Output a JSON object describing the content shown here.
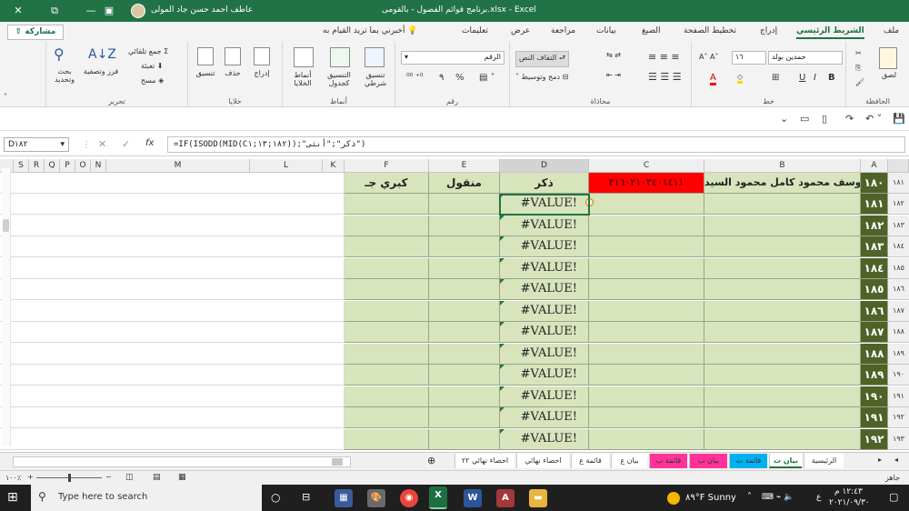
{
  "title_bar": {
    "title": "برنامج قوائم الفصول - بالقومى.xlsx - Excel",
    "user": "عاطف احمد حسن جاد المولى",
    "restore_symbol": "⧉",
    "min_symbol": "—",
    "max_symbol": "▢",
    "close_symbol": "✕"
  },
  "ribbon_tabs": [
    "ملف",
    "الشريط الرئيسي",
    "إدراج",
    "تخطيط الصفحة",
    "الصيغ",
    "بيانات",
    "مراجعة",
    "عرض",
    "تعليمات"
  ],
  "tell_me": "أخبرني بما تريد القيام به",
  "share_label": "مشاركة",
  "ribbon": {
    "clipboard": {
      "label": "الحافظة",
      "paste": "لصق"
    },
    "font": {
      "label": "خط",
      "font_name": "حمدين بولد",
      "font_size": "١٦",
      "bold": "B",
      "italic": "I",
      "underline": "U"
    },
    "alignment": {
      "label": "محاذاة",
      "wrap": "التفاف النص",
      "merge": "دمج وتوسيط"
    },
    "number": {
      "label": "رقم",
      "format": "الرقم",
      "percent": "%",
      "comma": "٩"
    },
    "styles": {
      "label": "أنماط",
      "conditional": "تنسيق شرطي",
      "as_table": "التنسيق كجدول",
      "cell_styles": "أنماط الخلايا"
    },
    "cells": {
      "label": "خلايا",
      "insert": "إدراج",
      "delete": "حذف",
      "format": "تنسيق"
    },
    "editing": {
      "label": "تحرير",
      "autosum": "جمع تلقائي",
      "fill": "تعبئة",
      "clear": "مسح",
      "sort": "فرز وتصفية",
      "find": "بحث وتحديد"
    }
  },
  "name_box": "D١٨٢",
  "formula": "=IF(ISODD(MID(C١٨٢;١٣;١));\"ذكر\";\"أنثى\")",
  "columns": [
    "A",
    "B",
    "C",
    "D",
    "E",
    "F",
    "K",
    "L",
    "M",
    "N",
    "O",
    "P",
    "Q",
    "R",
    "S"
  ],
  "header_row": {
    "row_num": "١٨١",
    "a": "١٨٠",
    "b": "يوسف محمود كامل محمود السيد",
    "c": "٣١٦٠٢١٠٣٤٠١٤١١",
    "d": "ذكر",
    "e": "منقول",
    "f": "كبري  جـ"
  },
  "rows": [
    {
      "row": "١٨٢",
      "a": "١٨١",
      "d": "#VALUE!"
    },
    {
      "row": "١٨٣",
      "a": "١٨٢",
      "d": "#VALUE!"
    },
    {
      "row": "١٨٤",
      "a": "١٨٣",
      "d": "#VALUE!"
    },
    {
      "row": "١٨٥",
      "a": "١٨٤",
      "d": "#VALUE!"
    },
    {
      "row": "١٨٦",
      "a": "١٨٥",
      "d": "#VALUE!"
    },
    {
      "row": "١٨٧",
      "a": "١٨٦",
      "d": "#VALUE!"
    },
    {
      "row": "١٨٨",
      "a": "١٨٧",
      "d": "#VALUE!"
    },
    {
      "row": "١٨٩",
      "a": "١٨٨",
      "d": "#VALUE!"
    },
    {
      "row": "١٩٠",
      "a": "١٨٩",
      "d": "#VALUE!"
    },
    {
      "row": "١٩١",
      "a": "١٩٠",
      "d": "#VALUE!"
    },
    {
      "row": "١٩٢",
      "a": "١٩١",
      "d": "#VALUE!"
    },
    {
      "row": "١٩٣",
      "a": "١٩٢",
      "d": "#VALUE!"
    }
  ],
  "sheet_tabs": [
    {
      "label": "الرئيسية",
      "color": "#ffffff"
    },
    {
      "label": "بيان ت",
      "color": "#ffffff",
      "active": true
    },
    {
      "label": "قائمة ت",
      "color": "#00b0f0"
    },
    {
      "label": "بيان ب",
      "color": "#ff3399"
    },
    {
      "label": "قائمة ب",
      "color": "#ff3399"
    },
    {
      "label": "بيان ع",
      "color": "#ffffff"
    },
    {
      "label": "قائمة ع",
      "color": "#ffffff"
    },
    {
      "label": "احصاء نهائي",
      "color": "#ffffff"
    },
    {
      "label": "احصاء نهائي ٢٢",
      "color": "#ffffff"
    }
  ],
  "status": {
    "left": "جاهز",
    "zoom": "١٠٠٪"
  },
  "taskbar": {
    "search": "Type here to search",
    "weather": "٨٩°F  Sunny",
    "time": "١٢:٤٣ م",
    "date": "٢٠٢١/٠٩/٣٠",
    "lang": "ع"
  },
  "colors": {
    "accent": "#217346",
    "num_col": "#4f6228",
    "cell_fill": "#d8e4bc",
    "c_header": "#ff0000"
  }
}
